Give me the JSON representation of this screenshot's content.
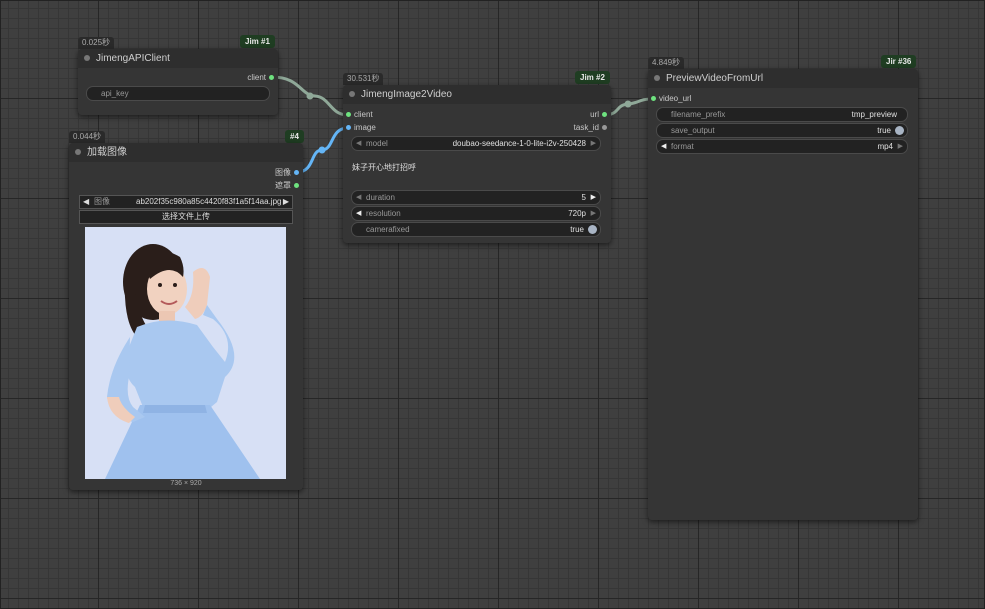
{
  "colors": {
    "link_client": "#8fa898",
    "link_image": "#64b5f6",
    "link_url": "#8fa898",
    "badge_bg": "#1f3d22"
  },
  "client_node": {
    "timing": "0.025秒",
    "badge": "Jim  #1",
    "title": "JimengAPIClient",
    "output_client": "client",
    "widget_api_key": "api_key"
  },
  "load_node": {
    "timing": "0.044秒",
    "badge": "#4",
    "title": "加载图像",
    "output_image": "图像",
    "output_mask": "遮罩",
    "image_label": "图像",
    "image_value": "ab202f35c980a85c4420f83f1a5f14aa.jpg",
    "upload_label": "选择文件上传",
    "dims": "736 × 920"
  },
  "video_node": {
    "timing": "30.531秒",
    "badge": "Jim  #2",
    "title": "JimengImage2Video",
    "input_client": "client",
    "input_image": "image",
    "output_url": "url",
    "output_task": "task_id",
    "model_label": "model",
    "model_value": "doubao-seedance-1-0-lite-i2v-250428",
    "prompt": "妹子开心地打招呼",
    "duration_label": "duration",
    "duration_value": "5",
    "resolution_label": "resolution",
    "resolution_value": "720p",
    "camerafixed_label": "camerafixed",
    "camerafixed_value": "true"
  },
  "preview_node": {
    "timing": "4.849秒",
    "badge": "Jir  #36",
    "title": "PreviewVideoFromUrl",
    "input_video_url": "video_url",
    "filename_prefix_label": "filename_prefix",
    "filename_prefix_value": "tmp_preview",
    "save_output_label": "save_output",
    "save_output_value": "true",
    "format_label": "format",
    "format_value": "mp4"
  }
}
